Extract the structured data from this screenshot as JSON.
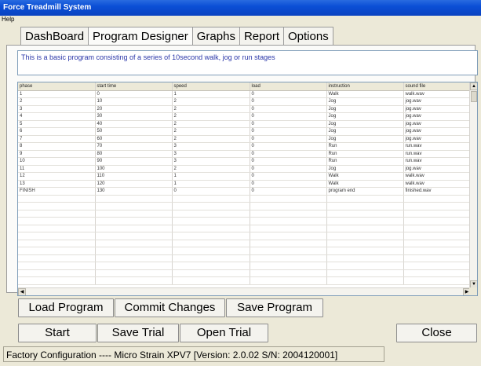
{
  "window": {
    "title": "Force Treadmill System"
  },
  "menu": {
    "help": "Help"
  },
  "tabs": [
    {
      "label": "DashBoard"
    },
    {
      "label": "Program Designer"
    },
    {
      "label": "Graphs"
    },
    {
      "label": "Report"
    },
    {
      "label": "Options"
    }
  ],
  "description": "This is a basic program consisting of a series of 10second walk, jog or run stages",
  "table": {
    "columns": [
      "phase",
      "start time",
      "speed",
      "load",
      "instruction",
      "sound file"
    ],
    "rows": [
      [
        "1",
        "0",
        "1",
        "0",
        "Walk",
        "walk.wav"
      ],
      [
        "2",
        "10",
        "2",
        "0",
        "Jog",
        "jog.wav"
      ],
      [
        "3",
        "20",
        "2",
        "0",
        "Jog",
        "jog.wav"
      ],
      [
        "4",
        "30",
        "2",
        "0",
        "Jog",
        "jog.wav"
      ],
      [
        "5",
        "40",
        "2",
        "0",
        "Jog",
        "jog.wav"
      ],
      [
        "6",
        "50",
        "2",
        "0",
        "Jog",
        "jog.wav"
      ],
      [
        "7",
        "60",
        "2",
        "0",
        "Jog",
        "jog.wav"
      ],
      [
        "8",
        "70",
        "3",
        "0",
        "Run",
        "run.wav"
      ],
      [
        "9",
        "80",
        "3",
        "0",
        "Run",
        "run.wav"
      ],
      [
        "10",
        "90",
        "3",
        "0",
        "Run",
        "run.wav"
      ],
      [
        "11",
        "100",
        "2",
        "0",
        "Jog",
        "jog.wav"
      ],
      [
        "12",
        "110",
        "1",
        "0",
        "Walk",
        "walk.wav"
      ],
      [
        "13",
        "120",
        "1",
        "0",
        "Walk",
        "walk.wav"
      ],
      [
        "FINISH",
        "130",
        "0",
        "0",
        "program end",
        "finished.wav"
      ]
    ]
  },
  "program_buttons": {
    "load": "Load Program",
    "commit": "Commit Changes",
    "save": "Save Program"
  },
  "trial_buttons": {
    "start": "Start",
    "save_trial": "Save Trial",
    "open_trial": "Open Trial",
    "close": "Close"
  },
  "status": "Factory Configuration  ----  Micro Strain XPV7 [Version: 2.0.02 S/N: 2004120001]"
}
